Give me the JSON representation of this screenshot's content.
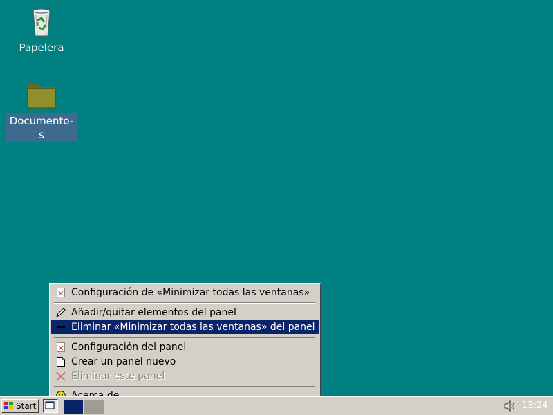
{
  "desktop": {
    "icons": [
      {
        "label": "Papelera",
        "icon": "trash-icon"
      },
      {
        "label": "Documento-s",
        "icon": "folder-icon"
      }
    ]
  },
  "context_menu": {
    "items": [
      {
        "label": "Configuración de «Minimizar todas las ventanas»",
        "icon": "properties-icon"
      },
      {
        "label": "Añadir/quitar elementos del panel",
        "icon": "pencil-icon"
      },
      {
        "label": "Eliminar «Minimizar todas las ventanas» del panel",
        "icon": "remove-icon",
        "highlighted": true
      },
      {
        "label": "Configuración del panel",
        "icon": "properties-icon"
      },
      {
        "label": "Crear un panel nuevo",
        "icon": "new-document-icon"
      },
      {
        "label": "Eliminar este panel",
        "icon": "delete-icon",
        "disabled": true
      },
      {
        "label": "Acerca de",
        "icon": "smiley-icon"
      }
    ]
  },
  "panel": {
    "start_label": "Start",
    "clock": "13:24"
  },
  "colors": {
    "desktop": "#008080",
    "highlight": "#0a246a",
    "panel": "#d4d0c8"
  }
}
